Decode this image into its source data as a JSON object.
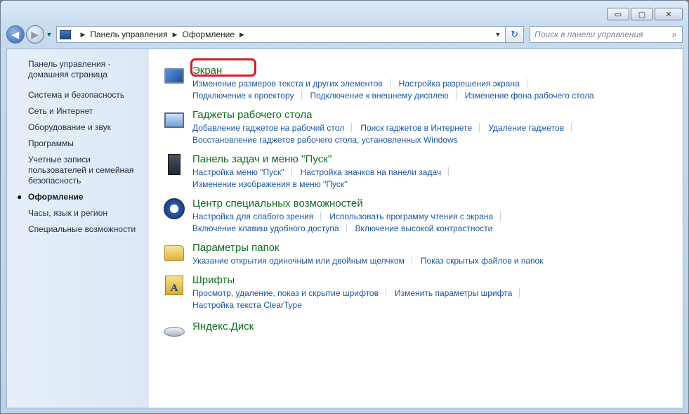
{
  "window": {
    "controls": {
      "minimize": "▭",
      "maximize": "▢",
      "close": "✕"
    }
  },
  "navbar": {
    "breadcrumbs": [
      "Панель управления",
      "Оформление"
    ],
    "search_placeholder": "Поиск в панели управления"
  },
  "sidebar": {
    "home": "Панель управления - домашняя страница",
    "items": [
      "Система и безопасность",
      "Сеть и Интернет",
      "Оборудование и звук",
      "Программы",
      "Учетные записи пользователей и семейная безопасность",
      "Оформление",
      "Часы, язык и регион",
      "Специальные возможности"
    ],
    "active_item": "Оформление"
  },
  "categories": [
    {
      "title": "Экран",
      "icon": "monitor-icon",
      "rows": [
        [
          "Изменение размеров текста и других элементов",
          "Настройка разрешения экрана"
        ],
        [
          "Подключение к проектору",
          "Подключение к внешнему дисплею",
          "Изменение фона рабочего стола"
        ]
      ]
    },
    {
      "title": "Гаджеты рабочего стола",
      "icon": "gadgets-icon",
      "rows": [
        [
          "Добавление гаджетов на рабочий стол",
          "Поиск гаджетов в Интернете",
          "Удаление гаджетов"
        ],
        [
          "Восстановление гаджетов рабочего стола, установленных Windows"
        ]
      ]
    },
    {
      "title": "Панель задач и меню ''Пуск''",
      "icon": "taskbar-icon",
      "rows": [
        [
          "Настройка меню \"Пуск\"",
          "Настройка значков на панели задач"
        ],
        [
          "Изменение изображения в меню \"Пуск\""
        ]
      ]
    },
    {
      "title": "Центр специальных возможностей",
      "icon": "accessibility-icon",
      "rows": [
        [
          "Настройка для слабого зрения",
          "Использовать программу чтения с экрана"
        ],
        [
          "Включение клавиш удобного доступа",
          "Включение высокой контрастности"
        ]
      ]
    },
    {
      "title": "Параметры папок",
      "icon": "folder-options-icon",
      "rows": [
        [
          "Указание открытия одиночным или двойным щелчком",
          "Показ скрытых файлов и папок"
        ]
      ]
    },
    {
      "title": "Шрифты",
      "icon": "fonts-icon",
      "rows": [
        [
          "Просмотр, удаление, показ и скрытие шрифтов",
          "Изменить параметры шрифта"
        ],
        [
          "Настройка текста ClearType"
        ]
      ]
    },
    {
      "title": "Яндекс.Диск",
      "icon": "yandex-disk-icon",
      "rows": []
    }
  ],
  "colors": {
    "title_green": "#0f6d1e",
    "link_blue": "#1a55a8",
    "highlight_red": "#d31d24"
  }
}
